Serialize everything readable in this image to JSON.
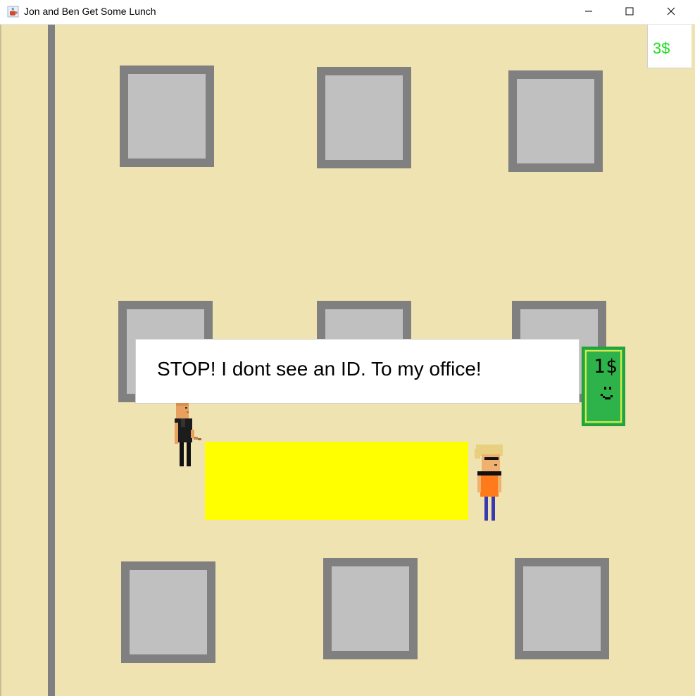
{
  "window": {
    "title": "Jon and Ben Get Some Lunch",
    "app_icon": "java-cup-icon",
    "controls": [
      "minimize-icon",
      "maximize-icon",
      "close-icon"
    ]
  },
  "hud": {
    "money": "3$"
  },
  "dialog": {
    "text": "STOP! I dont see an ID. To my office!"
  },
  "pickup": {
    "label": "1$",
    "icon": "smiley-face-icon"
  },
  "colors": {
    "floor": "#f0e3b2",
    "desk_border": "#808080",
    "desk_fill": "#c0c0c0",
    "money_text": "#22dd22",
    "bill": "#2db34a",
    "highlight_zone": "#ffff00"
  },
  "characters": [
    "security-guard",
    "player-ben"
  ]
}
